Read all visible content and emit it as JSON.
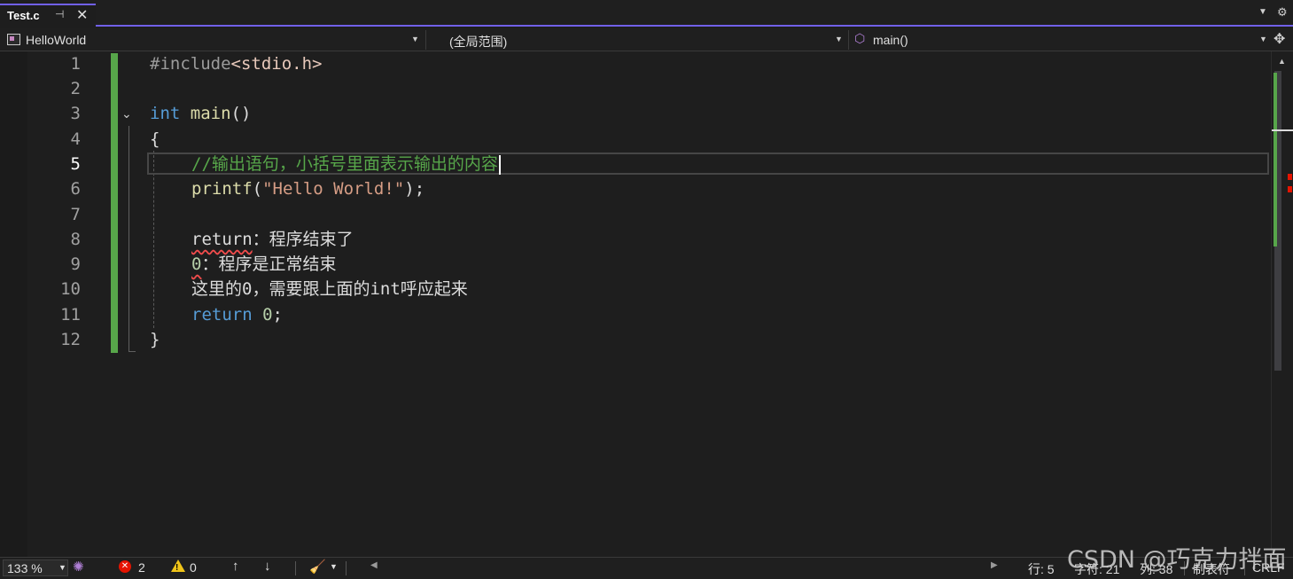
{
  "tab": {
    "title": "Test.c",
    "pin_icon": "pin-icon",
    "close_icon": "close-icon"
  },
  "navbar": {
    "project": "HelloWorld",
    "scope": "(全局范围)",
    "member": "main()"
  },
  "editor": {
    "line_numbers": [
      "1",
      "2",
      "3",
      "4",
      "5",
      "6",
      "7",
      "8",
      "9",
      "10",
      "11",
      "12"
    ],
    "current_line": 5,
    "lines": {
      "l1_pp": "#include",
      "l1_inc": "<stdio.h>",
      "l3_kw": "int",
      "l3_fn": "main",
      "l3_rest": "()",
      "l4": "{",
      "l5_comment": "//输出语句，小括号里面表示输出的内容",
      "l6_fn": "printf",
      "l6_open": "(",
      "l6_str": "\"Hello World!\"",
      "l6_close": ");",
      "l8_err": "return",
      "l8_rest": "：程序结束了",
      "l9_num": "0",
      "l9_rest": "：程序是正常结束",
      "l10": "这里的0，需要跟上面的int呼应起来",
      "l11_kw": "return",
      "l11_num": "0",
      "l11_semi": ";",
      "l12": "}"
    }
  },
  "statusbar": {
    "zoom": "133 %",
    "errors": "2",
    "warnings": "0",
    "line": "行: 5",
    "char": "字符: 21",
    "col": "列: 38",
    "indent": "制表符",
    "eol": "CRLF"
  },
  "watermark": "CSDN @巧克力拌面",
  "colors": {
    "accent": "#7160e8",
    "keyword": "#569cd6",
    "function": "#dcdcaa",
    "string": "#d69d85",
    "comment": "#57a64a",
    "number": "#b5cea8",
    "error": "#e51400"
  }
}
